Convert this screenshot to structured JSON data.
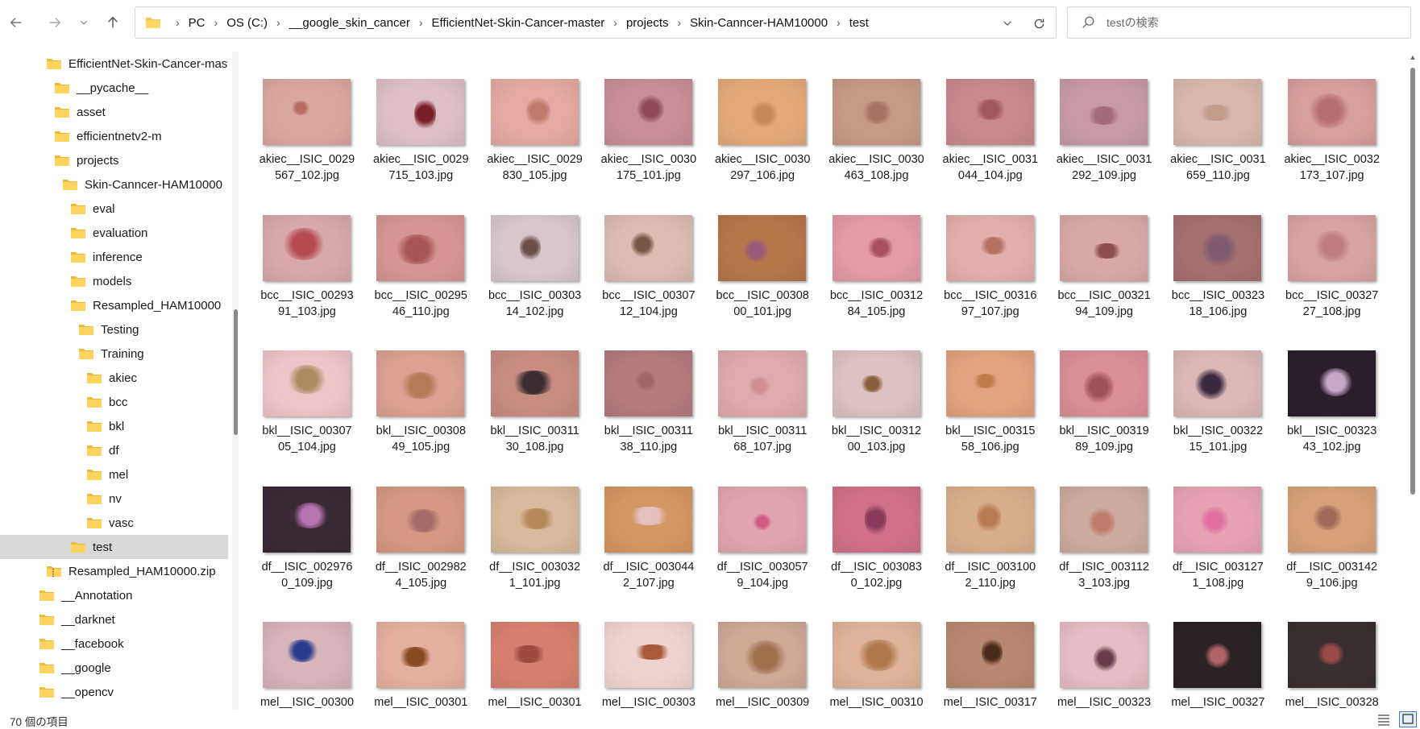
{
  "toolbar": {
    "breadcrumbs": [
      "PC",
      "OS (C:)",
      "__google_skin_cancer",
      "EfficientNet-Skin-Cancer-master",
      "projects",
      "Skin-Canncer-HAM10000",
      "test"
    ],
    "search_placeholder": "testの検索"
  },
  "sidebar": {
    "items": [
      {
        "label": "EfficientNet-Skin-Cancer-mast",
        "level": 2,
        "icon": "folder-icon"
      },
      {
        "label": "__pycache__",
        "level": 3,
        "icon": "folder-icon"
      },
      {
        "label": "asset",
        "level": 3,
        "icon": "folder-icon"
      },
      {
        "label": "efficientnetv2-m",
        "level": 3,
        "icon": "folder-icon"
      },
      {
        "label": "projects",
        "level": 3,
        "icon": "folder-icon"
      },
      {
        "label": "Skin-Canncer-HAM10000",
        "level": 4,
        "icon": "folder-icon"
      },
      {
        "label": "eval",
        "level": 5,
        "icon": "folder-icon"
      },
      {
        "label": "evaluation",
        "level": 5,
        "icon": "folder-icon"
      },
      {
        "label": "inference",
        "level": 5,
        "icon": "folder-icon"
      },
      {
        "label": "models",
        "level": 5,
        "icon": "folder-icon"
      },
      {
        "label": "Resampled_HAM10000",
        "level": 5,
        "icon": "folder-icon"
      },
      {
        "label": "Testing",
        "level": 6,
        "icon": "folder-icon"
      },
      {
        "label": "Training",
        "level": 6,
        "icon": "folder-icon"
      },
      {
        "label": "akiec",
        "level": 7,
        "icon": "folder-icon"
      },
      {
        "label": "bcc",
        "level": 7,
        "icon": "folder-icon"
      },
      {
        "label": "bkl",
        "level": 7,
        "icon": "folder-icon"
      },
      {
        "label": "df",
        "level": 7,
        "icon": "folder-icon"
      },
      {
        "label": "mel",
        "level": 7,
        "icon": "folder-icon"
      },
      {
        "label": "nv",
        "level": 7,
        "icon": "folder-icon"
      },
      {
        "label": "vasc",
        "level": 7,
        "icon": "folder-icon"
      },
      {
        "label": "test",
        "level": 5,
        "icon": "folder-icon",
        "selected": true
      },
      {
        "label": "Resampled_HAM10000.zip",
        "level": 2,
        "icon": "zip-folder-icon"
      },
      {
        "label": "__Annotation",
        "level": 1,
        "icon": "folder-icon"
      },
      {
        "label": "__darknet",
        "level": 1,
        "icon": "folder-icon"
      },
      {
        "label": "__facebook",
        "level": 1,
        "icon": "folder-icon"
      },
      {
        "label": "__google",
        "level": 1,
        "icon": "folder-icon"
      },
      {
        "label": "__opencv",
        "level": 1,
        "icon": "folder-icon"
      }
    ]
  },
  "files": [
    {
      "name": "akiec__ISIC_0029\n567_102.jpg",
      "bg": "#d9a7a0",
      "spot": "#b86b63"
    },
    {
      "name": "akiec__ISIC_0029\n715_103.jpg",
      "bg": "#dcc0c6",
      "spot": "#7a1f2a"
    },
    {
      "name": "akiec__ISIC_0029\n830_105.jpg",
      "bg": "#e6a9a3",
      "spot": "#c07b6e"
    },
    {
      "name": "akiec__ISIC_0030\n175_101.jpg",
      "bg": "#c98e98",
      "spot": "#8e4a58"
    },
    {
      "name": "akiec__ISIC_0030\n297_106.jpg",
      "bg": "#e4a97a",
      "spot": "#c58a5a"
    },
    {
      "name": "akiec__ISIC_0030\n463_108.jpg",
      "bg": "#c79a86",
      "spot": "#a37365"
    },
    {
      "name": "akiec__ISIC_0031\n044_104.jpg",
      "bg": "#c9898e",
      "spot": "#a35860"
    },
    {
      "name": "akiec__ISIC_0031\n292_109.jpg",
      "bg": "#c99aa6",
      "spot": "#a56a7a"
    },
    {
      "name": "akiec__ISIC_0031\n659_110.jpg",
      "bg": "#d9b7ae",
      "spot": "#c49a8d"
    },
    {
      "name": "akiec__ISIC_0032\n173_107.jpg",
      "bg": "#d89e9e",
      "spot": "#b76e70"
    },
    {
      "name": "bcc__ISIC_00293\n91_103.jpg",
      "bg": "#d8a8ac",
      "spot": "#b54a52"
    },
    {
      "name": "bcc__ISIC_00295\n46_110.jpg",
      "bg": "#d69594",
      "spot": "#a55555"
    },
    {
      "name": "bcc__ISIC_00303\n14_102.jpg",
      "bg": "#d7c7cc",
      "spot": "#6a5048"
    },
    {
      "name": "bcc__ISIC_00307\n12_104.jpg",
      "bg": "#dcbcb4",
      "spot": "#7a5545"
    },
    {
      "name": "bcc__ISIC_00308\n00_101.jpg",
      "bg": "#b5764a",
      "spot": "#9c5a7a"
    },
    {
      "name": "bcc__ISIC_00312\n84_105.jpg",
      "bg": "#e39aa4",
      "spot": "#a85060"
    },
    {
      "name": "bcc__ISIC_00316\n97_107.jpg",
      "bg": "#e2afae",
      "spot": "#b57060"
    },
    {
      "name": "bcc__ISIC_00321\n94_109.jpg",
      "bg": "#d8a8a6",
      "spot": "#8e4e4e"
    },
    {
      "name": "bcc__ISIC_00323\n18_106.jpg",
      "bg": "#a47070",
      "spot": "#7e5a70"
    },
    {
      "name": "bcc__ISIC_00327\n27_108.jpg",
      "bg": "#d8a2a4",
      "spot": "#c07e82"
    },
    {
      "name": "bkl__ISIC_00307\n05_104.jpg",
      "bg": "#efc3c7",
      "spot": "#b08a60"
    },
    {
      "name": "bkl__ISIC_00308\n49_105.jpg",
      "bg": "#dca092",
      "spot": "#b47a55"
    },
    {
      "name": "bkl__ISIC_00311\n30_108.jpg",
      "bg": "#c88c82",
      "spot": "#3a2e33"
    },
    {
      "name": "bkl__ISIC_00311\n38_110.jpg",
      "bg": "#b47a7e",
      "spot": "#a06668"
    },
    {
      "name": "bkl__ISIC_00311\n68_107.jpg",
      "bg": "#e0aaae",
      "spot": "#cf8e94"
    },
    {
      "name": "bkl__ISIC_00312\n00_103.jpg",
      "bg": "#dcc2c2",
      "spot": "#8a5e3a"
    },
    {
      "name": "bkl__ISIC_00315\n58_106.jpg",
      "bg": "#e2a27e",
      "spot": "#c07a48"
    },
    {
      "name": "bkl__ISIC_00319\n89_109.jpg",
      "bg": "#da8e98",
      "spot": "#a0505a"
    },
    {
      "name": "bkl__ISIC_00322\n15_101.jpg",
      "bg": "#dcb8b8",
      "spot": "#3a2a3e"
    },
    {
      "name": "bkl__ISIC_00323\n43_102.jpg",
      "bg": "#2a1e2a",
      "spot": "#c7a8c8"
    },
    {
      "name": "df__ISIC_002976\n0_109.jpg",
      "bg": "#3a2a36",
      "spot": "#b774b0"
    },
    {
      "name": "df__ISIC_002982\n4_105.jpg",
      "bg": "#d69882",
      "spot": "#a66a6a"
    },
    {
      "name": "df__ISIC_003032\n1_101.jpg",
      "bg": "#d8ba9c",
      "spot": "#b88a5a"
    },
    {
      "name": "df__ISIC_003044\n2_107.jpg",
      "bg": "#d49662",
      "spot": "#e6c0c0"
    },
    {
      "name": "df__ISIC_003057\n9_104.jpg",
      "bg": "#e2a4ae",
      "spot": "#d05a86"
    },
    {
      "name": "df__ISIC_003083\n0_102.jpg",
      "bg": "#d07088",
      "spot": "#8a3a5a"
    },
    {
      "name": "df__ISIC_003100\n2_110.jpg",
      "bg": "#d8ae8a",
      "spot": "#b87a50"
    },
    {
      "name": "df__ISIC_003112\n3_103.jpg",
      "bg": "#cbaaa0",
      "spot": "#c07a6a"
    },
    {
      "name": "df__ISIC_003127\n1_108.jpg",
      "bg": "#e7a2b4",
      "spot": "#e070a0"
    },
    {
      "name": "df__ISIC_003142\n9_106.jpg",
      "bg": "#d8a078",
      "spot": "#a06a5a"
    },
    {
      "name": "mel__ISIC_00300",
      "bg": "#d8b4bc",
      "spot": "#2c3c8a"
    },
    {
      "name": "mel__ISIC_00301",
      "bg": "#e6b0a0",
      "spot": "#8a4a20"
    },
    {
      "name": "mel__ISIC_00301",
      "bg": "#d8806e",
      "spot": "#9a4a3a"
    },
    {
      "name": "mel__ISIC_00303",
      "bg": "#eed4d0",
      "spot": "#a85a3a"
    },
    {
      "name": "mel__ISIC_00309",
      "bg": "#cfa896",
      "spot": "#a0704a"
    },
    {
      "name": "mel__ISIC_00310",
      "bg": "#e0b49a",
      "spot": "#b0784a"
    },
    {
      "name": "mel__ISIC_00317",
      "bg": "#b88870",
      "spot": "#4a2a1a"
    },
    {
      "name": "mel__ISIC_00323",
      "bg": "#e8bcc4",
      "spot": "#6a3a4a"
    },
    {
      "name": "mel__ISIC_00327",
      "bg": "#2a2224",
      "spot": "#b0646a"
    },
    {
      "name": "mel__ISIC_00328",
      "bg": "#3a3030",
      "spot": "#9a4a4a"
    }
  ],
  "status": {
    "item_count": "70 個の項目"
  }
}
